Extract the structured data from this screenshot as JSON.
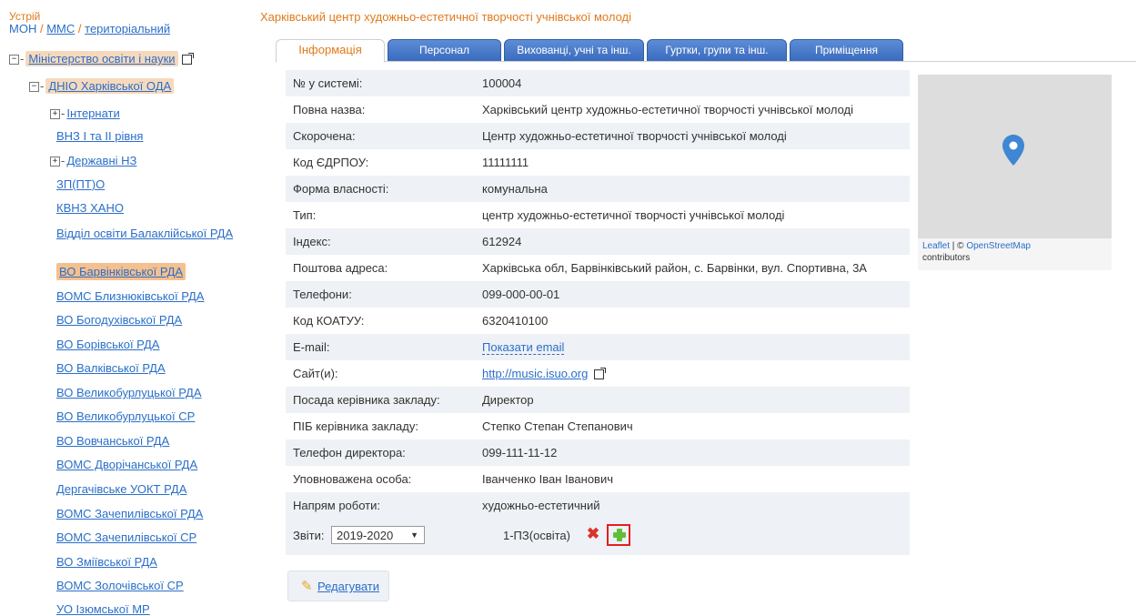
{
  "sidebar": {
    "device_label": "Устрій",
    "device_links": [
      "МОН",
      "ММС",
      "територіальний"
    ],
    "separator": "/",
    "root": "Міністерство освіти і науки",
    "region": "ДНІО Харківської ОДА",
    "items": [
      "Інтернати",
      "ВНЗ І та ІІ рівня",
      "Державні НЗ",
      "ЗП(ПТ)О",
      "КВНЗ ХАНО",
      "Відділ освіти Балаклійської РДА",
      "ВО Барвінківської РДА",
      "ВОМС Близнюківської РДА",
      "ВО Богодухівської РДА",
      "ВО Борівської РДА",
      "ВО Валківської РДА",
      "ВО Великобурлуцької РДА",
      "ВО Великобурлуцької СР",
      "ВО Вовчанської РДА",
      "ВОМС Дворічанської РДА",
      "Дергачівське УОКТ РДА",
      "ВОМС Зачепилівської РДА",
      "ВОМС Зачепилівської СР",
      "ВО Зміївської РДА",
      "ВОМС Золочівської СР",
      "УО Ізюмської МР"
    ]
  },
  "main": {
    "title": "Харківський центр художньо-естетичної творчості учнівської молоді",
    "tabs": [
      "Інформація",
      "Персонал",
      "Вихованці, учні та інш.",
      "Гуртки, групи та інш.",
      "Приміщення"
    ],
    "rows": [
      {
        "label": "№ у системі:",
        "value": "100004"
      },
      {
        "label": "Повна назва:",
        "value": "Харківський центр художньо-естетичної творчості учнівської молоді"
      },
      {
        "label": "Скорочена:",
        "value": "Центр художньо-естетичної творчості учнівської молоді"
      },
      {
        "label": "Код ЄДРПОУ:",
        "value": "11111111"
      },
      {
        "label": "Форма власності:",
        "value": "комунальна"
      },
      {
        "label": "Тип:",
        "value": "центр художньо-естетичної творчості учнівської молоді"
      },
      {
        "label": "Індекс:",
        "value": "612924"
      },
      {
        "label": "Поштова адреса:",
        "value": "Харківська обл, Барвінківський район, с. Барвінки, вул. Спортивна, 3А"
      },
      {
        "label": "Телефони:",
        "value": "099-000-00-01"
      },
      {
        "label": "Код КОАТУУ:",
        "value": "6320410100"
      },
      {
        "label": "E-mail:",
        "value": "Показати email"
      },
      {
        "label": "Сайт(и):",
        "value": "http://music.isuo.org"
      },
      {
        "label": "Посада керівника закладу:",
        "value": "Директор"
      },
      {
        "label": "ПІБ керівника закладу:",
        "value": "Степко Степан Степанович"
      },
      {
        "label": "Телефон директора:",
        "value": "099-111-11-12"
      },
      {
        "label": "Уповноважена особа:",
        "value": "Іванченко Іван Іванович"
      },
      {
        "label": "Напрям роботи:",
        "value": "художньо-естетичний"
      }
    ],
    "reports": {
      "label": "Звіти:",
      "year": "2019-2020",
      "report_name": "1-ПЗ(освіта)"
    },
    "edit_label": "Редагувати"
  },
  "map": {
    "attr_leaflet": "Leaflet",
    "attr_sep": " | © ",
    "attr_osm": "OpenStreetMap",
    "attr_contrib": "contributors"
  },
  "colors": {
    "accent_orange": "#e07a1a",
    "link_blue": "#2a6fc9",
    "tab_blue": "#3a6bbf",
    "row_alt": "#eef1f5",
    "highlight_red": "#e02020",
    "plus_green": "#5fbf3b"
  }
}
